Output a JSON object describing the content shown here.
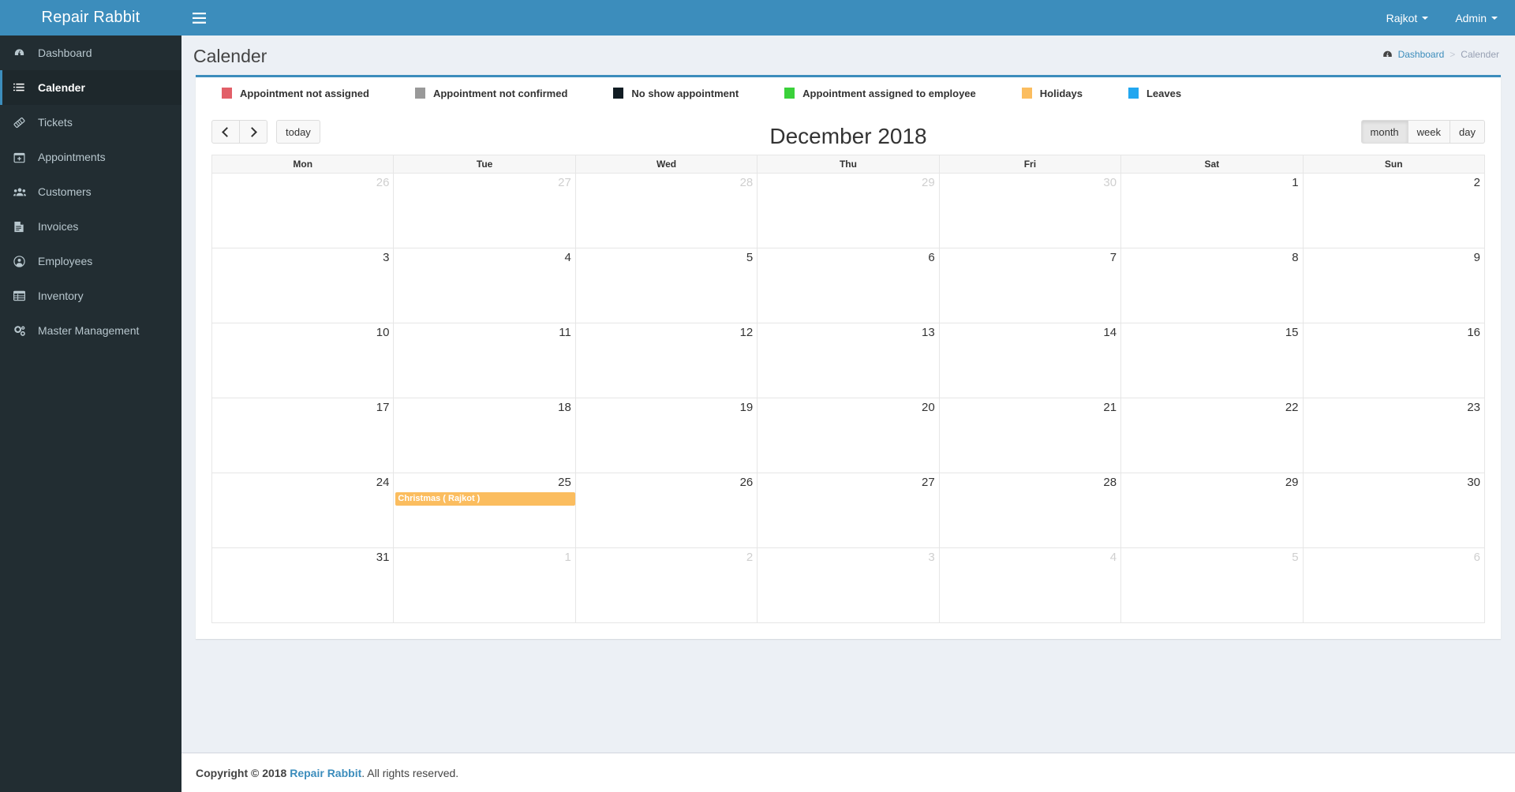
{
  "app": {
    "brand": "Repair Rabbit",
    "accent": "#3c8dbc",
    "sidebar_bg": "#222d32"
  },
  "navbar": {
    "toggle_label": "Toggle navigation",
    "location": "Rajkot",
    "user": "Admin"
  },
  "sidebar": {
    "items": [
      {
        "label": "Dashboard",
        "icon": "dashboard-icon",
        "active": false
      },
      {
        "label": "Calender",
        "icon": "calendar-list-icon",
        "active": true
      },
      {
        "label": "Tickets",
        "icon": "ticket-icon",
        "active": false
      },
      {
        "label": "Appointments",
        "icon": "calendar-plus-icon",
        "active": false
      },
      {
        "label": "Customers",
        "icon": "users-icon",
        "active": false
      },
      {
        "label": "Invoices",
        "icon": "file-invoice-icon",
        "active": false
      },
      {
        "label": "Employees",
        "icon": "user-circle-icon",
        "active": false
      },
      {
        "label": "Inventory",
        "icon": "table-icon",
        "active": false
      },
      {
        "label": "Master Management",
        "icon": "cogs-icon",
        "active": false
      }
    ]
  },
  "header": {
    "title": "Calender",
    "breadcrumb": [
      {
        "label": "Dashboard",
        "icon": "dashboard-icon",
        "link": true
      },
      {
        "label": "Calender",
        "link": false
      }
    ],
    "breadcrumb_separator": ">"
  },
  "legend": [
    {
      "label": "Appointment not assigned",
      "color": "#e25f68"
    },
    {
      "label": "Appointment not confirmed",
      "color": "#999999"
    },
    {
      "label": "No show appointment",
      "color": "#111c23"
    },
    {
      "label": "Appointment assigned to employee",
      "color": "#3ad13a"
    },
    {
      "label": "Holidays",
      "color": "#fbbd5f"
    },
    {
      "label": "Leaves",
      "color": "#22a7f0"
    }
  ],
  "calendar": {
    "prev_label": "prev",
    "next_label": "next",
    "today_label": "today",
    "title": "December 2018",
    "views": [
      {
        "label": "month",
        "active": true
      },
      {
        "label": "week",
        "active": false
      },
      {
        "label": "day",
        "active": false
      }
    ],
    "day_headers": [
      "Mon",
      "Tue",
      "Wed",
      "Thu",
      "Fri",
      "Sat",
      "Sun"
    ],
    "weeks": [
      [
        {
          "day": "26",
          "other": true,
          "events": []
        },
        {
          "day": "27",
          "other": true,
          "events": []
        },
        {
          "day": "28",
          "other": true,
          "events": []
        },
        {
          "day": "29",
          "other": true,
          "events": []
        },
        {
          "day": "30",
          "other": true,
          "events": []
        },
        {
          "day": "1",
          "other": false,
          "events": []
        },
        {
          "day": "2",
          "other": false,
          "events": []
        }
      ],
      [
        {
          "day": "3",
          "other": false,
          "events": []
        },
        {
          "day": "4",
          "other": false,
          "events": []
        },
        {
          "day": "5",
          "other": false,
          "events": []
        },
        {
          "day": "6",
          "other": false,
          "events": []
        },
        {
          "day": "7",
          "other": false,
          "events": []
        },
        {
          "day": "8",
          "other": false,
          "events": []
        },
        {
          "day": "9",
          "other": false,
          "events": []
        }
      ],
      [
        {
          "day": "10",
          "other": false,
          "events": []
        },
        {
          "day": "11",
          "other": false,
          "events": []
        },
        {
          "day": "12",
          "other": false,
          "events": []
        },
        {
          "day": "13",
          "other": false,
          "events": []
        },
        {
          "day": "14",
          "other": false,
          "events": []
        },
        {
          "day": "15",
          "other": false,
          "events": []
        },
        {
          "day": "16",
          "other": false,
          "events": []
        }
      ],
      [
        {
          "day": "17",
          "other": false,
          "events": []
        },
        {
          "day": "18",
          "other": false,
          "events": []
        },
        {
          "day": "19",
          "other": false,
          "events": []
        },
        {
          "day": "20",
          "other": false,
          "events": []
        },
        {
          "day": "21",
          "other": false,
          "events": []
        },
        {
          "day": "22",
          "other": false,
          "events": []
        },
        {
          "day": "23",
          "other": false,
          "events": []
        }
      ],
      [
        {
          "day": "24",
          "other": false,
          "events": []
        },
        {
          "day": "25",
          "other": false,
          "events": [
            {
              "title": "Christmas ( Rajkot )",
              "color": "#fbbd5f"
            }
          ]
        },
        {
          "day": "26",
          "other": false,
          "events": []
        },
        {
          "day": "27",
          "other": false,
          "events": []
        },
        {
          "day": "28",
          "other": false,
          "events": []
        },
        {
          "day": "29",
          "other": false,
          "events": []
        },
        {
          "day": "30",
          "other": false,
          "events": []
        }
      ],
      [
        {
          "day": "31",
          "other": false,
          "events": []
        },
        {
          "day": "1",
          "other": true,
          "events": []
        },
        {
          "day": "2",
          "other": true,
          "events": []
        },
        {
          "day": "3",
          "other": true,
          "events": []
        },
        {
          "day": "4",
          "other": true,
          "events": []
        },
        {
          "day": "5",
          "other": true,
          "events": []
        },
        {
          "day": "6",
          "other": true,
          "events": []
        }
      ]
    ]
  },
  "footer": {
    "prefix": "Copyright © 2018",
    "link": "Repair Rabbit",
    "suffix": ". All rights reserved."
  }
}
